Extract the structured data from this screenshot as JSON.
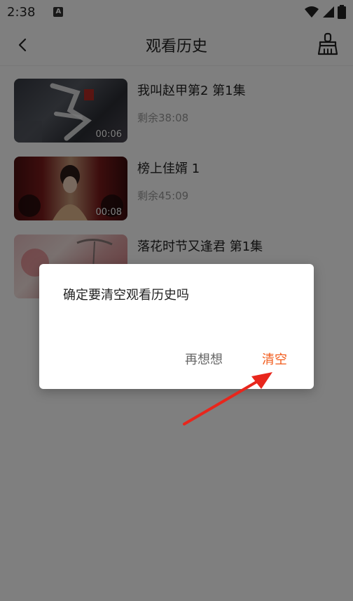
{
  "status_bar": {
    "time": "2:38",
    "notification_icon": "a-notification-icon",
    "wifi_icon": "wifi-icon",
    "signal_icon": "signal-icon",
    "battery_icon": "battery-icon"
  },
  "header": {
    "title": "观看历史",
    "back_icon": "chevron-left-icon",
    "clear_icon": "broom-icon"
  },
  "history": [
    {
      "title": "我叫赵甲第2 第1集",
      "thumb_time": "00:06",
      "remaining": "剩余38:08"
    },
    {
      "title": "榜上佳婿 1",
      "thumb_time": "00:08",
      "remaining": "剩余45:09"
    },
    {
      "title": "落花时节又逢君 第1集",
      "thumb_time": "",
      "remaining": ""
    }
  ],
  "dialog": {
    "message": "确定要清空观看历史吗",
    "cancel_label": "再想想",
    "confirm_label": "清空"
  },
  "colors": {
    "accent": "#f25c1c",
    "annotation": "#e8261c",
    "overlay": "rgba(0,0,0,0.5)"
  }
}
